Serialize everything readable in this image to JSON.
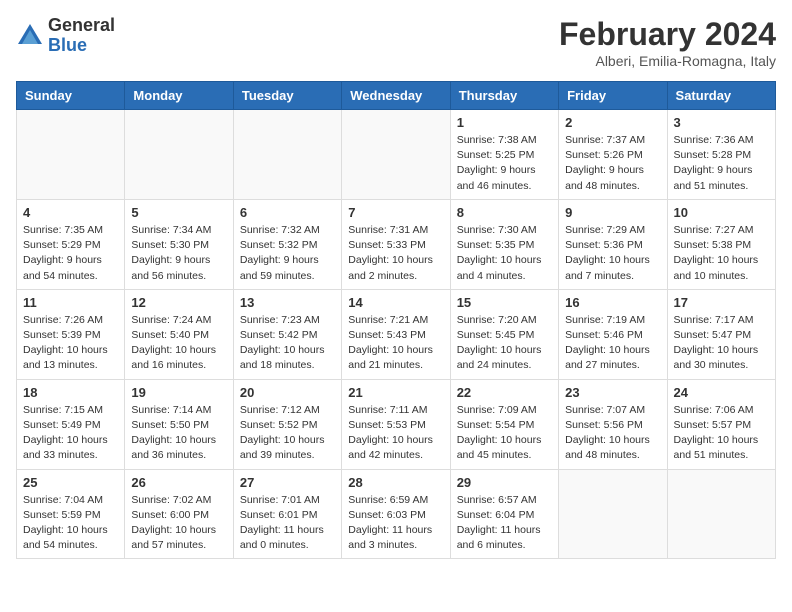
{
  "header": {
    "logo_general": "General",
    "logo_blue": "Blue",
    "month_title": "February 2024",
    "location": "Alberi, Emilia-Romagna, Italy"
  },
  "weekdays": [
    "Sunday",
    "Monday",
    "Tuesday",
    "Wednesday",
    "Thursday",
    "Friday",
    "Saturday"
  ],
  "weeks": [
    [
      {
        "day": "",
        "info": ""
      },
      {
        "day": "",
        "info": ""
      },
      {
        "day": "",
        "info": ""
      },
      {
        "day": "",
        "info": ""
      },
      {
        "day": "1",
        "info": "Sunrise: 7:38 AM\nSunset: 5:25 PM\nDaylight: 9 hours\nand 46 minutes."
      },
      {
        "day": "2",
        "info": "Sunrise: 7:37 AM\nSunset: 5:26 PM\nDaylight: 9 hours\nand 48 minutes."
      },
      {
        "day": "3",
        "info": "Sunrise: 7:36 AM\nSunset: 5:28 PM\nDaylight: 9 hours\nand 51 minutes."
      }
    ],
    [
      {
        "day": "4",
        "info": "Sunrise: 7:35 AM\nSunset: 5:29 PM\nDaylight: 9 hours\nand 54 minutes."
      },
      {
        "day": "5",
        "info": "Sunrise: 7:34 AM\nSunset: 5:30 PM\nDaylight: 9 hours\nand 56 minutes."
      },
      {
        "day": "6",
        "info": "Sunrise: 7:32 AM\nSunset: 5:32 PM\nDaylight: 9 hours\nand 59 minutes."
      },
      {
        "day": "7",
        "info": "Sunrise: 7:31 AM\nSunset: 5:33 PM\nDaylight: 10 hours\nand 2 minutes."
      },
      {
        "day": "8",
        "info": "Sunrise: 7:30 AM\nSunset: 5:35 PM\nDaylight: 10 hours\nand 4 minutes."
      },
      {
        "day": "9",
        "info": "Sunrise: 7:29 AM\nSunset: 5:36 PM\nDaylight: 10 hours\nand 7 minutes."
      },
      {
        "day": "10",
        "info": "Sunrise: 7:27 AM\nSunset: 5:38 PM\nDaylight: 10 hours\nand 10 minutes."
      }
    ],
    [
      {
        "day": "11",
        "info": "Sunrise: 7:26 AM\nSunset: 5:39 PM\nDaylight: 10 hours\nand 13 minutes."
      },
      {
        "day": "12",
        "info": "Sunrise: 7:24 AM\nSunset: 5:40 PM\nDaylight: 10 hours\nand 16 minutes."
      },
      {
        "day": "13",
        "info": "Sunrise: 7:23 AM\nSunset: 5:42 PM\nDaylight: 10 hours\nand 18 minutes."
      },
      {
        "day": "14",
        "info": "Sunrise: 7:21 AM\nSunset: 5:43 PM\nDaylight: 10 hours\nand 21 minutes."
      },
      {
        "day": "15",
        "info": "Sunrise: 7:20 AM\nSunset: 5:45 PM\nDaylight: 10 hours\nand 24 minutes."
      },
      {
        "day": "16",
        "info": "Sunrise: 7:19 AM\nSunset: 5:46 PM\nDaylight: 10 hours\nand 27 minutes."
      },
      {
        "day": "17",
        "info": "Sunrise: 7:17 AM\nSunset: 5:47 PM\nDaylight: 10 hours\nand 30 minutes."
      }
    ],
    [
      {
        "day": "18",
        "info": "Sunrise: 7:15 AM\nSunset: 5:49 PM\nDaylight: 10 hours\nand 33 minutes."
      },
      {
        "day": "19",
        "info": "Sunrise: 7:14 AM\nSunset: 5:50 PM\nDaylight: 10 hours\nand 36 minutes."
      },
      {
        "day": "20",
        "info": "Sunrise: 7:12 AM\nSunset: 5:52 PM\nDaylight: 10 hours\nand 39 minutes."
      },
      {
        "day": "21",
        "info": "Sunrise: 7:11 AM\nSunset: 5:53 PM\nDaylight: 10 hours\nand 42 minutes."
      },
      {
        "day": "22",
        "info": "Sunrise: 7:09 AM\nSunset: 5:54 PM\nDaylight: 10 hours\nand 45 minutes."
      },
      {
        "day": "23",
        "info": "Sunrise: 7:07 AM\nSunset: 5:56 PM\nDaylight: 10 hours\nand 48 minutes."
      },
      {
        "day": "24",
        "info": "Sunrise: 7:06 AM\nSunset: 5:57 PM\nDaylight: 10 hours\nand 51 minutes."
      }
    ],
    [
      {
        "day": "25",
        "info": "Sunrise: 7:04 AM\nSunset: 5:59 PM\nDaylight: 10 hours\nand 54 minutes."
      },
      {
        "day": "26",
        "info": "Sunrise: 7:02 AM\nSunset: 6:00 PM\nDaylight: 10 hours\nand 57 minutes."
      },
      {
        "day": "27",
        "info": "Sunrise: 7:01 AM\nSunset: 6:01 PM\nDaylight: 11 hours\nand 0 minutes."
      },
      {
        "day": "28",
        "info": "Sunrise: 6:59 AM\nSunset: 6:03 PM\nDaylight: 11 hours\nand 3 minutes."
      },
      {
        "day": "29",
        "info": "Sunrise: 6:57 AM\nSunset: 6:04 PM\nDaylight: 11 hours\nand 6 minutes."
      },
      {
        "day": "",
        "info": ""
      },
      {
        "day": "",
        "info": ""
      }
    ]
  ]
}
